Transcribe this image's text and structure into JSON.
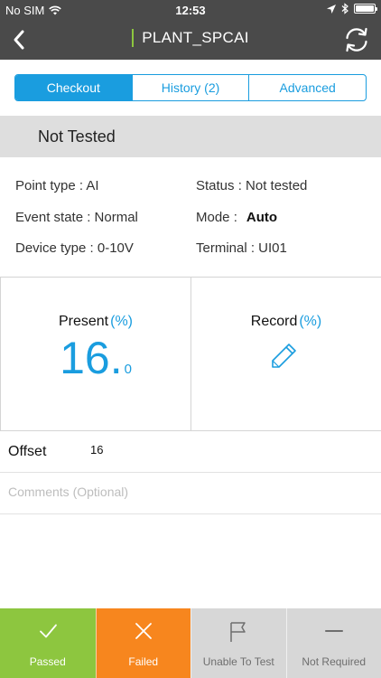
{
  "status_bar": {
    "carrier": "No SIM",
    "time": "12:53",
    "battery_level": 1.0
  },
  "nav": {
    "title": "PLANT_SPCAI",
    "back_icon": "chevron-left-icon",
    "sync_icon": "sync-icon"
  },
  "tabs": [
    {
      "label": "Checkout",
      "active": true
    },
    {
      "label": "History (2)",
      "active": false
    },
    {
      "label": "Advanced",
      "active": false
    }
  ],
  "test_status": "Not Tested",
  "info": {
    "point_type": "Point type : AI",
    "status": "Status : Not tested",
    "event_state": "Event state : Normal",
    "mode_label": "Mode :",
    "mode_value": "Auto",
    "device_type": "Device type : 0-10V",
    "terminal": "Terminal : UI01"
  },
  "present": {
    "label": "Present",
    "unit": "(%)",
    "integer": "16",
    "dot": ".",
    "decimal": "0"
  },
  "record": {
    "label": "Record",
    "unit": "(%)",
    "icon": "pencil-icon"
  },
  "offset": {
    "label": "Offset",
    "value": "16"
  },
  "comments": {
    "placeholder": "Comments (Optional)",
    "value": ""
  },
  "actions": [
    {
      "label": "Passed",
      "icon": "check-icon",
      "color": "#8dc63f"
    },
    {
      "label": "Failed",
      "icon": "x-icon",
      "color": "#f7861e"
    },
    {
      "label": "Unable To Test",
      "icon": "flag-icon",
      "color": "#d7d7d7"
    },
    {
      "label": "Not Required",
      "icon": "minus-icon",
      "color": "#d7d7d7"
    }
  ],
  "colors": {
    "accent_blue": "#1a9ddf",
    "header_bg": "#4a4a4a",
    "pass_green": "#8dc63f",
    "fail_orange": "#f7861e",
    "neutral_gray": "#d7d7d7"
  }
}
